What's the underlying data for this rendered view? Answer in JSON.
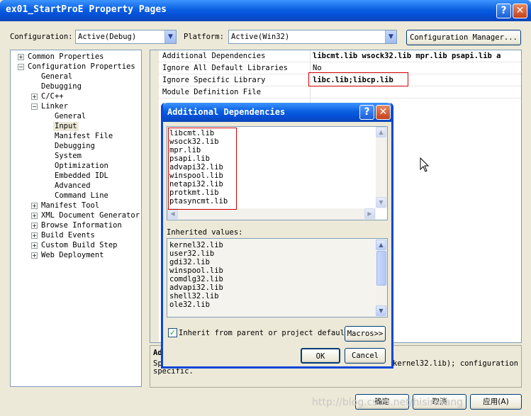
{
  "window": {
    "title": "ex01_StartProE Property Pages",
    "help": "?",
    "close": "✕"
  },
  "toolbar": {
    "configuration_label": "Configuration:",
    "configuration_value": "Active(Debug)",
    "platform_label": "Platform:",
    "platform_value": "Active(Win32)",
    "config_manager_label": "Configuration Manager..."
  },
  "tree": {
    "items": [
      {
        "label": "Common Properties",
        "exp": "+"
      },
      {
        "label": "Configuration Properties",
        "exp": "−"
      },
      {
        "label": "General"
      },
      {
        "label": "Debugging"
      },
      {
        "label": "C/C++",
        "exp": "+"
      },
      {
        "label": "Linker",
        "exp": "−"
      },
      {
        "label": "General"
      },
      {
        "label": "Input"
      },
      {
        "label": "Manifest File"
      },
      {
        "label": "Debugging"
      },
      {
        "label": "System"
      },
      {
        "label": "Optimization"
      },
      {
        "label": "Embedded IDL"
      },
      {
        "label": "Advanced"
      },
      {
        "label": "Command Line"
      },
      {
        "label": "Manifest Tool",
        "exp": "+"
      },
      {
        "label": "XML Document Generator",
        "exp": "+"
      },
      {
        "label": "Browse Information",
        "exp": "+"
      },
      {
        "label": "Build Events",
        "exp": "+"
      },
      {
        "label": "Custom Build Step",
        "exp": "+"
      },
      {
        "label": "Web Deployment",
        "exp": "+"
      }
    ]
  },
  "grid": {
    "rows": [
      {
        "name": "Additional Dependencies",
        "value": "libcmt.lib wsock32.lib mpr.lib psapi.lib a"
      },
      {
        "name": "Ignore All Default Libraries",
        "value": "No"
      },
      {
        "name": "Ignore Specific Library",
        "value": "libc.lib;libcp.lib"
      },
      {
        "name": "Module Definition File",
        "value": ""
      }
    ]
  },
  "description": {
    "heading": "Ad",
    "line1_start": "Sp",
    "line1_end": "kernel32.lib); configuration",
    "line2": "specific."
  },
  "dialog": {
    "title": "Additional Dependencies",
    "help": "?",
    "close": "✕",
    "dependencies": [
      "libcmt.lib",
      "wsock32.lib",
      "mpr.lib",
      "psapi.lib",
      "advapi32.lib",
      "winspool.lib",
      "netapi32.lib",
      "protkmt.lib",
      "ptasyncmt.lib"
    ],
    "inherited_label": "Inherited values:",
    "inherited": [
      "kernel32.lib",
      "user32.lib",
      "gdi32.lib",
      "winspool.lib",
      "comdlg32.lib",
      "advapi32.lib",
      "shell32.lib",
      "ole32.lib"
    ],
    "inherit_checkbox_label": "Inherit from parent or project default",
    "inherit_checked": true,
    "check_mark": "✓",
    "macros_label": "Macros>>",
    "ok_label": "OK",
    "cancel_label": "Cancel"
  },
  "footer": {
    "ok_label": "确定",
    "cancel_label": "取消",
    "apply_label": "应用(A)"
  },
  "watermark": "http://blog.csdn.net/hisinwang",
  "colors": {
    "accent": "#0a5fe0",
    "highlight_box": "#d00000",
    "selection": "#ece9d8"
  }
}
